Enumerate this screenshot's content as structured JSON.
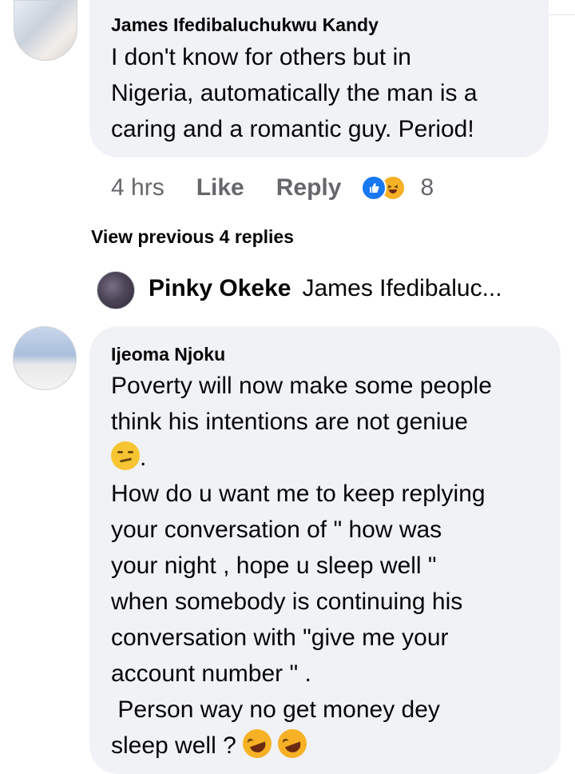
{
  "comment1": {
    "author": "James Ifedibaluchukwu Kandy",
    "text": "I don't know for others but in\nNigeria, automatically the man is a\ncaring and a romantic guy. Period!",
    "time": "4 hrs",
    "like_label": "Like",
    "reply_label": "Reply",
    "reaction_icons": [
      "like-icon",
      "haha-icon"
    ],
    "reaction_count": "8"
  },
  "view_previous": "View previous 4 replies",
  "reply_preview": {
    "author": "Pinky Okeke",
    "text": "James Ifedibaluc..."
  },
  "comment2": {
    "author": "Ijeoma Njoku",
    "line1": "Poverty will now make some people",
    "line2": "think his intentions are not geniue",
    "line3_suffix": ".",
    "line4_to_9": "How do u want me to keep replying\nyour conversation of \" how was\nyour night , hope u sleep well \"\nwhen somebody is continuing his\nconversation with \"give me your\naccount number \" .",
    "line10": " Person way no get money dey",
    "line11": "sleep well ? ",
    "emojis": [
      "smirk-emoji",
      "rofl-emoji",
      "rofl-emoji"
    ]
  },
  "colors": {
    "bubble": "#f0f2f5",
    "meta_text": "#65676b",
    "like_blue": "#1877f2",
    "haha_yellow": "#f7b125"
  }
}
